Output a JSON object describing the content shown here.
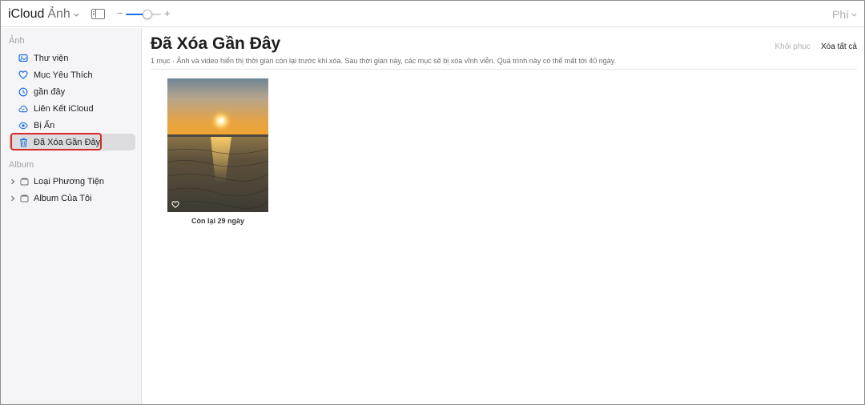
{
  "header": {
    "brand": "iCloud",
    "app": "Ảnh",
    "zoom_minus": "−",
    "zoom_plus": "+",
    "zoom_level": 0.62,
    "account": "Phí",
    "accent": "#1a6fe0"
  },
  "sidebar": {
    "section_photos": "Ảnh",
    "items": [
      {
        "label": "Thư viện",
        "icon": "photo-library-icon"
      },
      {
        "label": "Mục Yêu Thích",
        "icon": "heart-icon"
      },
      {
        "label": "gần đây",
        "icon": "clock-icon"
      },
      {
        "label": "Liên Kết iCloud",
        "icon": "cloud-link-icon"
      },
      {
        "label": "Bị Ẩn",
        "icon": "eye-icon"
      },
      {
        "label": "Đã Xóa Gần Đây",
        "icon": "trash-icon",
        "selected": true
      }
    ],
    "section_albums": "Album",
    "albums": [
      {
        "label": "Loại Phương Tiện",
        "icon": "folder-icon"
      },
      {
        "label": "Album Của Tôi",
        "icon": "folder-icon"
      }
    ]
  },
  "main": {
    "title": "Đã Xóa Gần Đây",
    "subtitle": "1 mục · Ảnh và video hiển thị thời gian còn lại trước khi xóa. Sau thời gian này, các mục sẽ bị xóa vĩnh viễn. Quá trình này có thể mất tới 40 ngày.",
    "restore_label": "Khôi phục",
    "delete_all_label": "Xóa tất cả",
    "photos": [
      {
        "caption": "Còn lại 29 ngày",
        "icon": "heart-outline-icon"
      }
    ]
  },
  "colors": {
    "icon_blue": "#1a6fe0",
    "highlight_red": "#d42a2a"
  }
}
